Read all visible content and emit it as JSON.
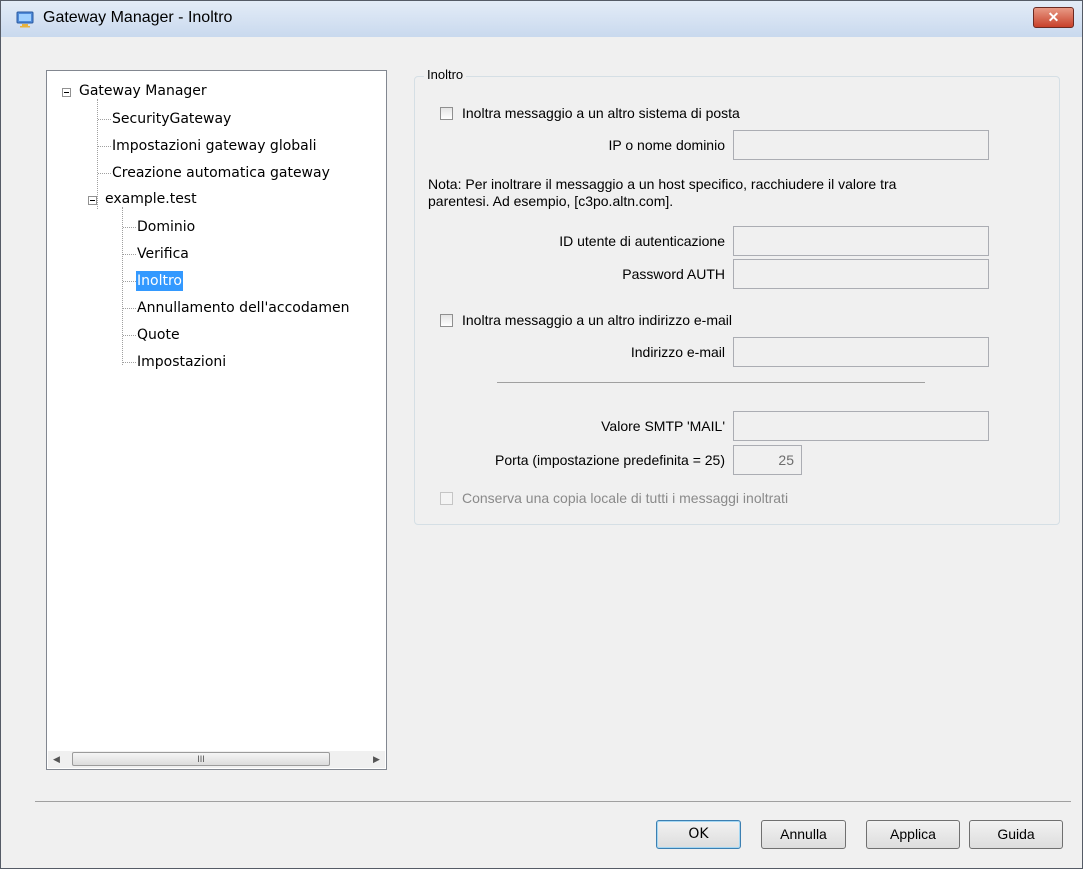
{
  "window": {
    "title": "Gateway Manager - Inoltro",
    "close_label": "✕"
  },
  "tree": {
    "items": [
      {
        "label": "Gateway Manager"
      },
      {
        "label": "SecurityGateway"
      },
      {
        "label": "Impostazioni gateway globali"
      },
      {
        "label": "Creazione automatica gateway"
      },
      {
        "label": "example.test"
      },
      {
        "label": "Dominio"
      },
      {
        "label": "Verifica"
      },
      {
        "label": "Inoltro",
        "selected": true
      },
      {
        "label": "Annullamento dell'accodamen"
      },
      {
        "label": "Quote"
      },
      {
        "label": "Impostazioni"
      }
    ],
    "scroll_thumb_label": "III"
  },
  "forwarding": {
    "group_title": "Inoltro",
    "forward_mail_system_label": "Inoltra messaggio a un altro sistema di posta",
    "forward_mail_system_checked": false,
    "ip_domain_label": "IP o nome dominio",
    "ip_domain_value": "",
    "note_line1": "Nota:  Per inoltrare il messaggio a un host specifico, racchiudere il valore tra",
    "note_line2": "parentesi.  Ad esempio, [c3po.altn.com].",
    "auth_user_label": "ID utente di autenticazione",
    "auth_user_value": "",
    "auth_password_label": "Password AUTH",
    "auth_password_value": "",
    "forward_email_label": "Inoltra messaggio a un altro indirizzo e-mail",
    "forward_email_checked": false,
    "email_address_label": "Indirizzo e-mail",
    "email_address_value": "",
    "smtp_mail_label": "Valore SMTP 'MAIL'",
    "smtp_mail_value": "",
    "port_label": "Porta (impostazione predefinita = 25)",
    "port_value": "25",
    "keep_copy_label": "Conserva una copia locale di tutti i messaggi inoltrati",
    "keep_copy_checked": false
  },
  "buttons": {
    "ok": "OK",
    "cancel": "Annulla",
    "apply": "Applica",
    "help": "Guida"
  },
  "colors": {
    "selection": "#3399ff",
    "title_gradient_top": "#e3ecf7",
    "close_red": "#c8412a"
  }
}
